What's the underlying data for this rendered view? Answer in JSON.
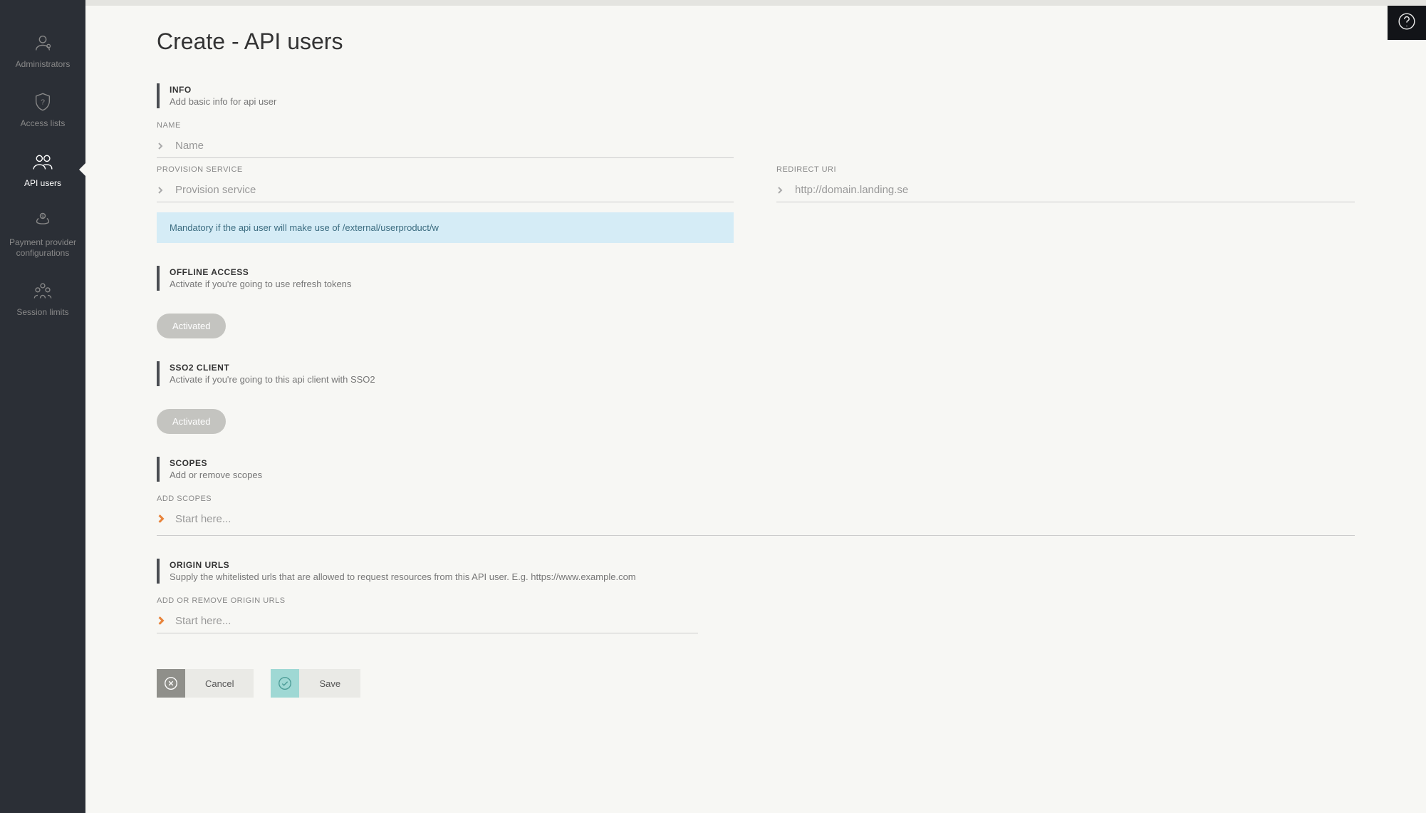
{
  "sidebar": {
    "items": [
      {
        "label": "Administrators"
      },
      {
        "label": "Access lists"
      },
      {
        "label": "API users"
      },
      {
        "label": "Payment provider configurations"
      },
      {
        "label": "Session limits"
      }
    ]
  },
  "page": {
    "title": "Create - API users"
  },
  "info": {
    "title": "INFO",
    "desc": "Add basic info for api user",
    "name_label": "NAME",
    "name_placeholder": "Name",
    "provision_label": "PROVISION SERVICE",
    "provision_placeholder": "Provision service",
    "redirect_label": "REDIRECT URI",
    "redirect_placeholder": "http://domain.landing.se",
    "mandatory_note": "Mandatory if the api user will make use of /external/userproduct/w"
  },
  "offline": {
    "title": "OFFLINE ACCESS",
    "desc": "Activate if you're going to use refresh tokens",
    "button": "Activated"
  },
  "sso2": {
    "title": "SSO2 CLIENT",
    "desc": "Activate if you're going to this api client with SSO2",
    "button": "Activated"
  },
  "scopes": {
    "title": "SCOPES",
    "desc": "Add or remove scopes",
    "add_label": "ADD SCOPES",
    "placeholder": "Start here..."
  },
  "origin": {
    "title": "ORIGIN URLS",
    "desc": "Supply the whitelisted urls that are allowed to request resources from this API user. E.g. https://www.example.com",
    "add_label": "ADD OR REMOVE ORIGIN URLS",
    "placeholder": "Start here..."
  },
  "actions": {
    "cancel": "Cancel",
    "save": "Save"
  }
}
